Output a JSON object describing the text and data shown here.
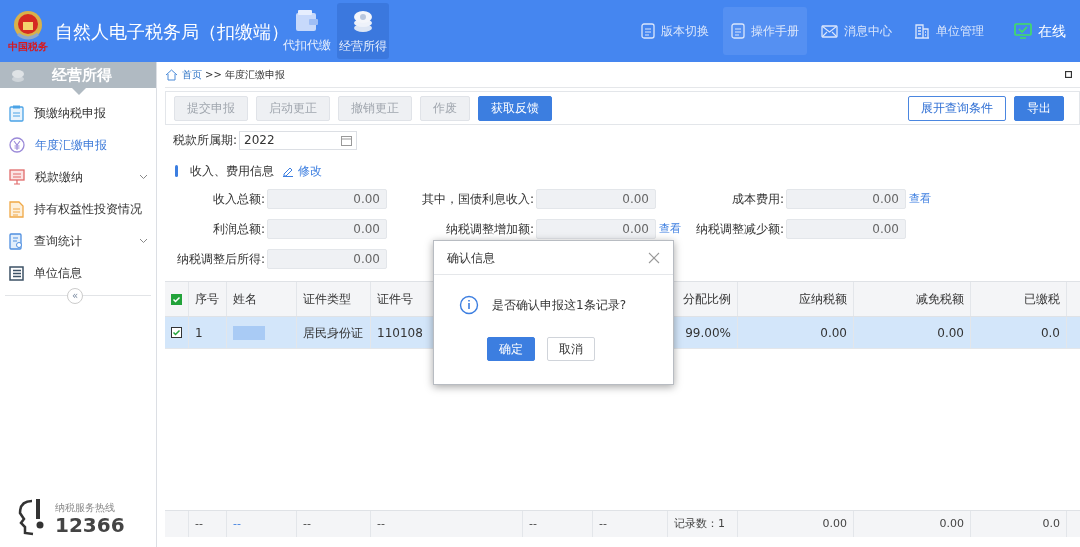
{
  "header": {
    "title": "自然人电子税务局（扣缴端）",
    "logo_caption": "中国税务",
    "nav_tabs": [
      {
        "label": "代扣代缴",
        "selected": false,
        "kind": "wallet"
      },
      {
        "label": "经营所得",
        "selected": true,
        "kind": "coins"
      }
    ],
    "links": [
      {
        "label": "版本切换",
        "selected": false,
        "kind": "doc"
      },
      {
        "label": "操作手册",
        "selected": true,
        "kind": "doc"
      },
      {
        "label": "消息中心",
        "selected": false,
        "kind": "mail"
      },
      {
        "label": "单位管理",
        "selected": false,
        "kind": "building"
      },
      {
        "label": "在线",
        "selected": false,
        "kind": "online"
      }
    ]
  },
  "sidebar": {
    "title": "经营所得",
    "items": [
      {
        "label": "预缴纳税申报",
        "selected": false,
        "expandable": false,
        "kind": "clipboard"
      },
      {
        "label": "年度汇缴申报",
        "selected": true,
        "expandable": false,
        "kind": "yen"
      },
      {
        "label": "税款缴纳",
        "selected": false,
        "expandable": true,
        "kind": "monitor"
      },
      {
        "label": "持有权益性投资情况",
        "selected": false,
        "expandable": false,
        "kind": "doc"
      },
      {
        "label": "查询统计",
        "selected": false,
        "expandable": true,
        "kind": "search"
      },
      {
        "label": "单位信息",
        "selected": false,
        "expandable": false,
        "kind": "list"
      }
    ],
    "collapse": "«",
    "hotline": {
      "label": "纳税服务热线",
      "number": "12366"
    }
  },
  "breadcrumb": {
    "home": "首页",
    "separator": ">>",
    "current": "年度汇缴申报"
  },
  "toolbar": {
    "buttons": [
      {
        "label": "提交申报",
        "kind": "default",
        "disabled": true
      },
      {
        "label": "启动更正",
        "kind": "default",
        "disabled": true
      },
      {
        "label": "撤销更正",
        "kind": "default",
        "disabled": true
      },
      {
        "label": "作废",
        "kind": "default",
        "disabled": true
      },
      {
        "label": "获取反馈",
        "kind": "primary",
        "disabled": false
      }
    ],
    "right_buttons": [
      {
        "label": "展开查询条件",
        "kind": "outline",
        "disabled": false
      },
      {
        "label": "导出",
        "kind": "primary",
        "disabled": false
      }
    ]
  },
  "period": {
    "label": "税款所属期:",
    "value": "2022"
  },
  "section": {
    "title": "收入、费用信息",
    "edit": "修改"
  },
  "fields": [
    {
      "label": "收入总额:",
      "value": "0.00"
    },
    {
      "label": "其中，国债利息收入:",
      "value": "0.00"
    },
    {
      "label": "成本费用:",
      "value": "0.00",
      "link": "查看"
    },
    {
      "label": "利润总额:",
      "value": "0.00"
    },
    {
      "label": "纳税调整增加额:",
      "value": "0.00",
      "link": "查看"
    },
    {
      "label": "纳税调整减少额:",
      "value": "0.00"
    },
    {
      "label": "纳税调整后所得:",
      "value": "0.00"
    }
  ],
  "table": {
    "all_checked": true,
    "columns": [
      {
        "label": "序号"
      },
      {
        "label": "姓名"
      },
      {
        "label": "证件类型"
      },
      {
        "label": "证件号"
      },
      null,
      null,
      {
        "label": "分配比例"
      },
      {
        "label": "应纳税额"
      },
      {
        "label": "减免税额"
      },
      {
        "label": "已缴税"
      }
    ],
    "rows": [
      {
        "checked": true,
        "selected": true,
        "cells": [
          "1",
          null,
          "居民身份证",
          "110108",
          null,
          null,
          "99.00%",
          "0.00",
          "0.00",
          "0.0"
        ]
      }
    ],
    "footer": [
      {
        "text": "--",
        "kind": "text"
      },
      {
        "text": "--",
        "kind": "link"
      },
      {
        "text": "--",
        "kind": "text"
      },
      {
        "text": "--",
        "kind": "text"
      },
      {
        "text": "--",
        "kind": "text"
      },
      {
        "text": "--",
        "kind": "text"
      },
      {
        "text": "记录数：1",
        "kind": "text"
      },
      {
        "text": "0.00",
        "kind": "text"
      },
      {
        "text": "0.00",
        "kind": "text"
      },
      {
        "text": "0.0",
        "kind": "text"
      }
    ]
  },
  "dialog": {
    "title": "确认信息",
    "message": "是否确认申报这1条记录?",
    "buttons": [
      {
        "label": "确定",
        "kind": "primary"
      },
      {
        "label": "取消",
        "kind": "default"
      }
    ]
  }
}
